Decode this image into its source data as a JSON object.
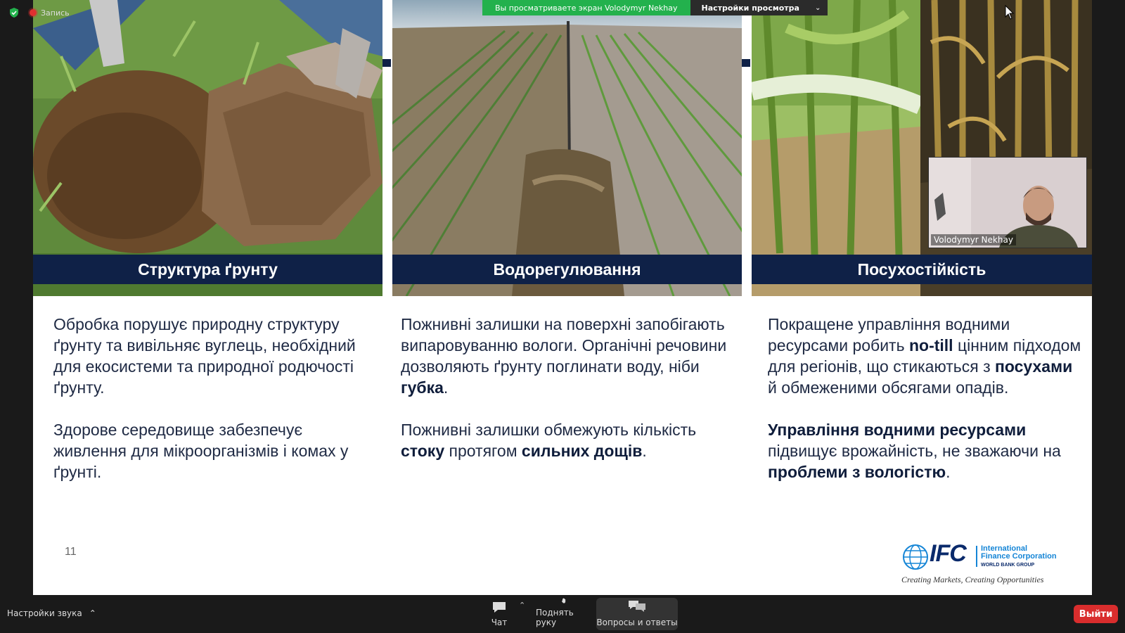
{
  "zoom": {
    "recording_label": "Запись",
    "share_banner": "Вы просматриваете экран Volodymyr Nekhay",
    "view_options": "Настройки просмотра",
    "presenter_name": "Volodymyr Nekhay",
    "audio_settings": "Настройки звука",
    "chat": "Чат",
    "raise_hand": "Поднять руку",
    "qa": "Вопросы и ответы",
    "leave": "Выйти"
  },
  "slide": {
    "panels": [
      {
        "caption": "Структура ґрунту"
      },
      {
        "caption": "Водорегулювання"
      },
      {
        "caption": "Посухостійкість"
      }
    ],
    "col1": {
      "p1": "Обробка порушує природну структуру ґрунту та вивільняє вуглець, необхідний для екосистеми та природної родючості ґрунту.",
      "p2": "Здорове середовище забезпечує живлення для мікроорганізмів і комах у ґрунті."
    },
    "col2": {
      "p1a": "Пожнивні залишки на поверхні запобігають випаровуванню вологи. Органічні речовини дозволяють ґрунту поглинати воду, ніби ",
      "p1b": "губка",
      "p1c": ".",
      "p2a": "Пожнивні залишки обмежують кількість ",
      "p2b": "стоку",
      "p2c": " протягом ",
      "p2d": "сильних дощів",
      "p2e": "."
    },
    "col3": {
      "p1a": "Покращене управління водними ресурсами робить ",
      "p1b": "no-till",
      "p1c": " цінним підходом для регіонів, що стикаються з ",
      "p1d": "посухами",
      "p1e": " й обмеженими обсягами опадів.",
      "p2a": "Управління водними ресурсами",
      "p2b": " підвищує врожайність, не зважаючи на ",
      "p2c": "проблеми з вологістю",
      "p2d": "."
    },
    "page_number": "11",
    "logo": {
      "ifc": "IFC",
      "line1": "International",
      "line2": "Finance Corporation",
      "line3": "WORLD BANK GROUP",
      "tagline": "Creating Markets, Creating Opportunities"
    }
  }
}
